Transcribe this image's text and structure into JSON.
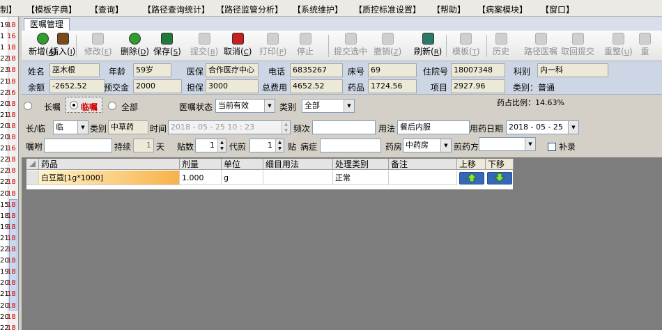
{
  "menu": [
    "制】",
    "【模板字典】",
    "【查询】",
    "【路径查询统计】",
    "【路径监管分析】",
    "【系统维护】",
    "【质控标准设置】",
    "【帮助】",
    "【病案模块】",
    "【窗口】"
  ],
  "left_strip": {
    "numbers": [
      "19",
      "1",
      "1",
      "22",
      "23",
      "21",
      "22",
      "20",
      "21",
      "20",
      "20",
      "21",
      "22",
      "22",
      "22",
      "20",
      "15",
      "18",
      "19",
      "21",
      "22",
      "20",
      "19",
      "20",
      "21",
      "20",
      "20",
      "22"
    ],
    "markers": [
      "18",
      "16",
      "18",
      "18",
      "18",
      "18",
      "16",
      "18",
      "18",
      "18",
      "18",
      "16",
      "18",
      "18",
      "18",
      "18",
      "18",
      "18",
      "18",
      "18",
      "18",
      "18",
      "18",
      "18",
      "18",
      "18",
      "18",
      "18"
    ]
  },
  "tab_title": "医嘱管理",
  "toolbar": [
    {
      "label": "新增",
      "key": "A",
      "icon": "plus-icon",
      "color": "#2e9e2e",
      "enabled": true
    },
    {
      "label": "插入",
      "key": "I",
      "icon": "insert-icon",
      "color": "#7a4a1a",
      "enabled": true
    },
    {
      "label": "修改",
      "key": "E",
      "icon": "edit-icon",
      "color": "#cfcfcf",
      "enabled": false
    },
    {
      "label": "删除",
      "key": "D",
      "icon": "minus-icon",
      "color": "#2e9e2e",
      "enabled": true
    },
    {
      "label": "保存",
      "key": "S",
      "icon": "save-icon",
      "color": "#1f7a3a",
      "enabled": true
    },
    {
      "label": "提交",
      "key": "B",
      "icon": "submit-icon",
      "color": "#cfcfcf",
      "enabled": false
    },
    {
      "label": "取消",
      "key": "C",
      "icon": "undo-icon",
      "color": "#c81e1e",
      "enabled": true
    },
    {
      "label": "打印",
      "key": "P",
      "icon": "print-icon",
      "color": "#cfcfcf",
      "enabled": false
    },
    {
      "label": "停止",
      "key": "",
      "icon": "stop-icon",
      "color": "#cfcfcf",
      "enabled": false
    },
    {
      "label": "提交选中",
      "key": "",
      "icon": "submit-selected-icon",
      "color": "#cfcfcf",
      "enabled": false
    },
    {
      "label": "撤销",
      "key": "Z",
      "icon": "revoke-icon",
      "color": "#cfcfcf",
      "enabled": false
    },
    {
      "label": "刷新",
      "key": "R",
      "icon": "refresh-icon",
      "color": "#2a7a6a",
      "enabled": true
    },
    {
      "label": "模板",
      "key": "T",
      "icon": "template-icon",
      "color": "#cfcfcf",
      "enabled": false
    },
    {
      "label": "历史",
      "key": "",
      "icon": "history-icon",
      "color": "#cfcfcf",
      "enabled": false
    },
    {
      "label": "路径医嘱",
      "key": "",
      "icon": "pathway-order-icon",
      "color": "#cfcfcf",
      "enabled": false
    },
    {
      "label": "取回提交",
      "key": "",
      "icon": "retrieve-icon",
      "color": "#cfcfcf",
      "enabled": false
    },
    {
      "label": "重整",
      "key": "U",
      "icon": "reorganize-icon",
      "color": "#cfcfcf",
      "enabled": false
    },
    {
      "label": "重",
      "key": "",
      "icon": "more-icon",
      "color": "#cfcfcf",
      "enabled": false
    }
  ],
  "patient": {
    "name_label": "姓名",
    "name": "巫木根",
    "age_label": "年龄",
    "age": "59岁",
    "insurance_label": "医保",
    "insurance": "合作医疗中心",
    "phone_label": "电话",
    "phone": "6835267",
    "bed_label": "床号",
    "bed": "69",
    "admission_label": "住院号",
    "admission": "18007348",
    "dept_label": "科别",
    "dept": "内一科",
    "balance_label": "余额",
    "balance": "-2652.52",
    "deposit_label": "预交金",
    "deposit": "2000",
    "guarantee_label": "担保",
    "guarantee": "3000",
    "total_label": "总费用",
    "total": "4652.52",
    "drug_label": "药品",
    "drug": "1724.56",
    "item_label": "项目",
    "item": "2927.96",
    "category_text": "类别：普通"
  },
  "mode": {
    "long_label": "长嘱",
    "temp_label": "临嘱",
    "all_label": "全部",
    "status_label": "医嘱状态",
    "status_value": "当前有效",
    "type_label": "类别",
    "type_value": "全部",
    "drug_ratio": "药占比例：14.63%"
  },
  "order": {
    "longtemp_label": "长/临",
    "longtemp_value": "临",
    "cat_label": "类别",
    "cat_value": "中草药",
    "time_label": "时间",
    "time_value": "2018 - 05 - 25   10 : 23",
    "freq_label": "频次",
    "freq_value": "",
    "usage_label": "用法",
    "usage_value": "餐后内服",
    "date_label": "用药日期",
    "date_value": "2018 - 05 - 25",
    "advice_label": "嘱咐",
    "advice_value": "",
    "duration_label": "持续",
    "duration_value": "1",
    "duration_unit": "天",
    "doses_label": "贴数",
    "doses_value": "1",
    "decoct_label": "代煎",
    "decoct_value": "1",
    "decoct_unit": "贴",
    "disease_label": "病症",
    "disease_value": "",
    "pharmacy_label": "药房",
    "pharmacy_value": "中药房",
    "decoction_label": "煎药方",
    "decoction_value": "",
    "supplement_label": "补录"
  },
  "grid": {
    "headers": [
      "药品",
      "剂量",
      "单位",
      "细目用法",
      "处理类别",
      "备注",
      "上移",
      "下移"
    ],
    "rows": [
      [
        "白豆蔻[1g*1000]",
        "1.000",
        "g",
        "",
        "正常",
        ""
      ]
    ]
  }
}
